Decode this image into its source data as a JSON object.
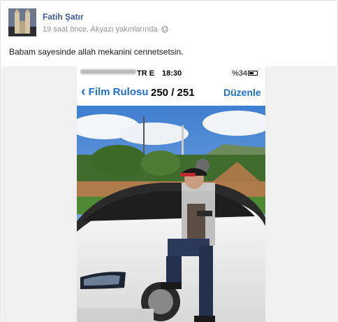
{
  "post": {
    "author": "Fatih Şatır",
    "meta": "19 saat önce, Akyazı yakınlarında",
    "privacy_icon": "globe-icon",
    "text": "Babam sayesinde allah mekanini cennetsetsin."
  },
  "phone_screenshot": {
    "status": {
      "network": "TR  E",
      "time": "18:30",
      "battery": "%34"
    },
    "nav": {
      "back_label": "Film Rulosu",
      "counter": "250 / 251",
      "edit_label": "Düzenle"
    }
  }
}
